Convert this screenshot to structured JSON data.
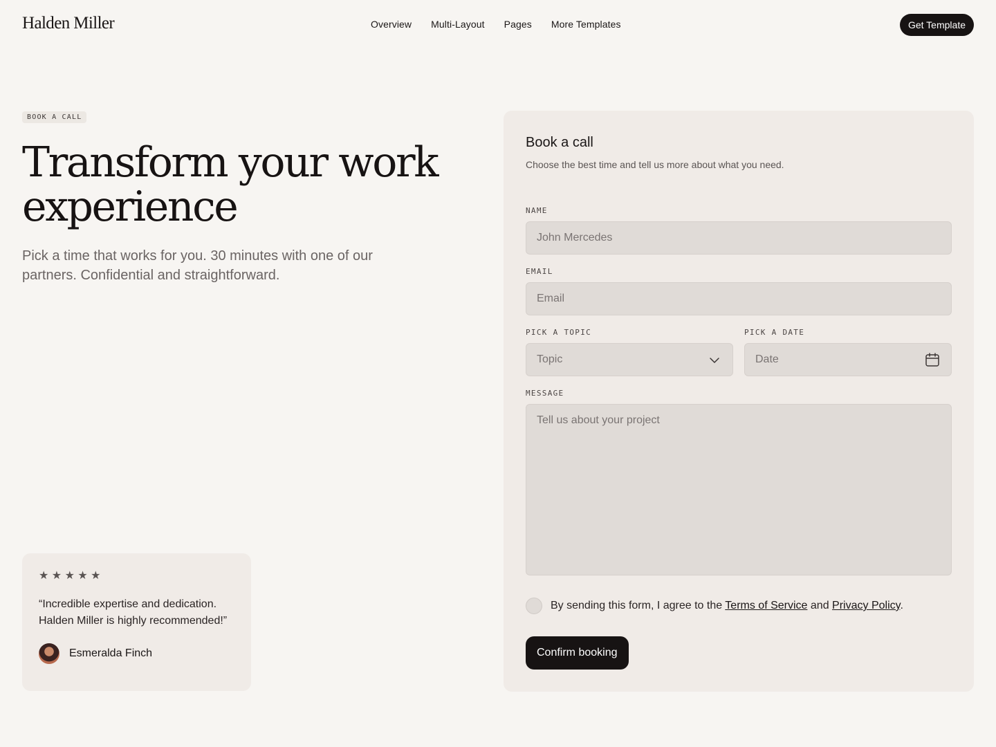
{
  "header": {
    "logo": "Halden Miller",
    "nav": [
      "Overview",
      "Multi-Layout",
      "Pages",
      "More Templates"
    ],
    "cta": "Get Template"
  },
  "hero": {
    "badge": "BOOK A CALL",
    "title": "Transform your work experience",
    "subtitle": "Pick a time that works for you. 30 minutes with one of our partners. Confidential and straightforward."
  },
  "testimonial": {
    "rating": 5,
    "stars": "★ ★ ★ ★ ★",
    "quote": "“Incredible expertise and dedication. Halden Miller is highly recommended!”",
    "author": "Esmeralda Finch"
  },
  "form": {
    "title": "Book a call",
    "subtitle": "Choose the best time and tell us more about what you need.",
    "name": {
      "label": "NAME",
      "placeholder": "John Mercedes"
    },
    "email": {
      "label": "EMAIL",
      "placeholder": "Email"
    },
    "topic": {
      "label": "PICK A TOPIC",
      "placeholder": "Topic"
    },
    "date": {
      "label": "PICK A DATE",
      "placeholder": "Date"
    },
    "message": {
      "label": "MESSAGE",
      "placeholder": "Tell us about your project"
    },
    "consent": {
      "prefix": "By sending this form, I agree to the",
      "terms": "Terms of Service",
      "and": "and",
      "privacy": "Privacy Policy",
      "suffix": "."
    },
    "submit": "Confirm booking"
  },
  "colors": {
    "background": "#f7f5f2",
    "card": "#f0ebe7",
    "field": "#e0dbd7",
    "primary": "#171313"
  }
}
